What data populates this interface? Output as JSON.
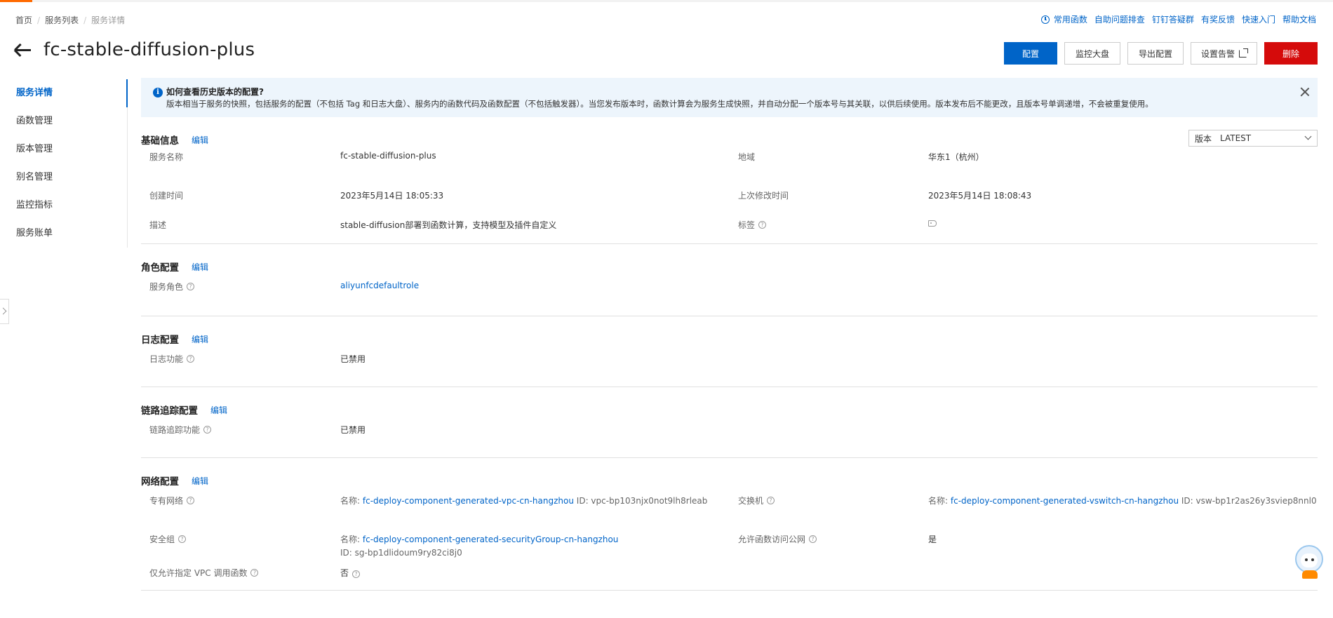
{
  "breadcrumb": {
    "home": "首页",
    "list": "服务列表",
    "current": "服务详情"
  },
  "quicklinks": [
    "常用函数",
    "自助问题排查",
    "钉钉答疑群",
    "有奖反馈",
    "快速入门",
    "帮助文档"
  ],
  "title": "fc-stable-diffusion-plus",
  "actions": {
    "config": "配置",
    "monitor": "监控大盘",
    "export": "导出配置",
    "alarm": "设置告警",
    "delete": "删除"
  },
  "sidenav": [
    "服务详情",
    "函数管理",
    "版本管理",
    "别名管理",
    "监控指标",
    "服务账单"
  ],
  "notice": {
    "title": "如何查看历史版本的配置?",
    "body": "版本相当于服务的快照，包括服务的配置（不包括 Tag 和日志大盘）、服务内的函数代码及函数配置（不包括触发器）。当您发布版本时，函数计算会为服务生成快照，并自动分配一个版本号与其关联，以供后续使用。版本发布后不能更改，且版本号单调递增，不会被重复使用。"
  },
  "edit_label": "编辑",
  "basic": {
    "title": "基础信息",
    "version_label": "版本",
    "version_value": "LATEST",
    "service_name_label": "服务名称",
    "service_name": "fc-stable-diffusion-plus",
    "region_label": "地域",
    "region": "华东1（杭州）",
    "created_label": "创建时间",
    "created": "2023年5月14日 18:05:33",
    "modified_label": "上次修改时间",
    "modified": "2023年5月14日 18:08:43",
    "desc_label": "描述",
    "desc": "stable-diffusion部署到函数计算，支持模型及插件自定义",
    "tags_label": "标签"
  },
  "role": {
    "title": "角色配置",
    "label": "服务角色",
    "value": "aliyunfcdefaultrole"
  },
  "log": {
    "title": "日志配置",
    "label": "日志功能",
    "value": "已禁用"
  },
  "trace": {
    "title": "链路追踪配置",
    "label": "链路追踪功能",
    "value": "已禁用"
  },
  "network": {
    "title": "网络配置",
    "vpc_label": "专有网络",
    "name_prefix": "名称:",
    "vpc_name": "fc-deploy-component-generated-vpc-cn-hangzhou",
    "vpc_id": "ID: vpc-bp103njx0not9lh8rleab",
    "vswitch_label": "交换机",
    "vswitch_name": "fc-deploy-component-generated-vswitch-cn-hangzhou",
    "vswitch_id": "ID: vsw-bp1r2as26y3sviep8nnl0",
    "sg_label": "安全组",
    "sg_name": "fc-deploy-component-generated-securityGroup-cn-hangzhou",
    "sg_id": "ID: sg-bp1dlidoum9ry82ci8j0",
    "internet_label": "允许函数访问公网",
    "internet_value": "是",
    "vpc_only_label": "仅允许指定 VPC 调用函数",
    "vpc_only_value": "否"
  },
  "colors": {
    "primary": "#0064c8",
    "danger": "#d50b0b",
    "accent": "#ff6a00",
    "notice_bg": "#edf5fc"
  }
}
